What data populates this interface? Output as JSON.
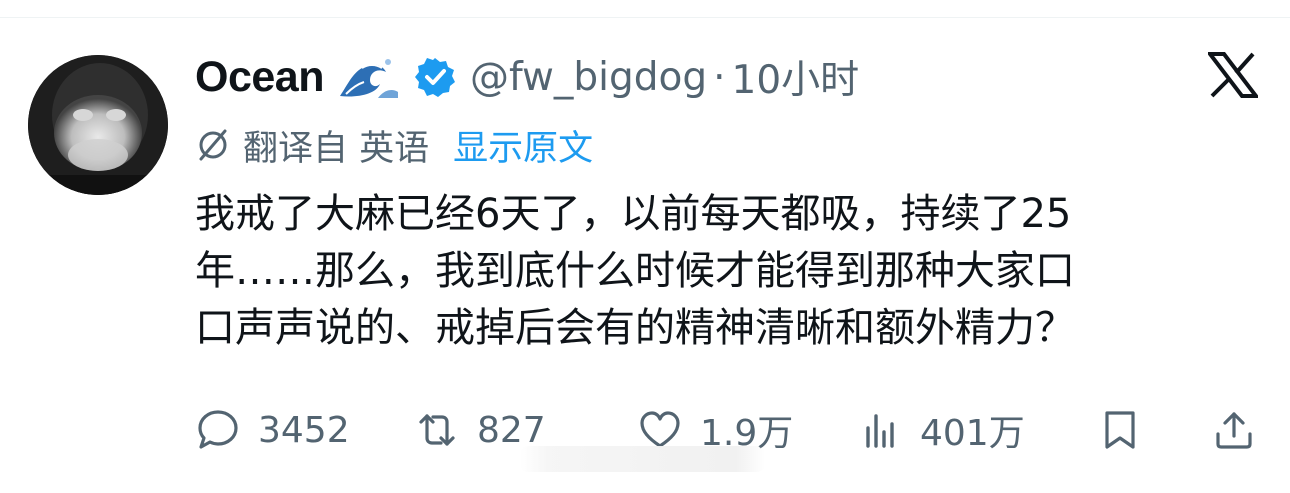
{
  "author": {
    "display_name": "Ocean",
    "handle": "@fw_bigdog",
    "separator": "·",
    "time": "10小时"
  },
  "translation": {
    "label": "翻译自 英语",
    "show_original": "显示原文"
  },
  "tweet": {
    "lines": [
      "我戒了大麻已经6天了，以前每天都吸，持续了25",
      "年……那么，我到底什么时候才能得到那种大家口",
      "口声声说的、戒掉后会有的精神清晰和额外精力？"
    ]
  },
  "actions": {
    "replies": "3452",
    "reposts": "827",
    "likes": "1.9万",
    "views": "401万"
  },
  "icons": {
    "platform_logo": "x-logo-icon",
    "verified": "verified-badge-icon",
    "emoji": "water-wave-emoji-icon",
    "translate": "translate-icon",
    "reply": "reply-icon",
    "repost": "repost-icon",
    "like": "heart-icon",
    "views": "views-chart-icon",
    "bookmark": "bookmark-icon",
    "share": "share-icon"
  },
  "colors": {
    "text_primary": "#0f1419",
    "text_secondary": "#536471",
    "link": "#1d9bf0",
    "verified": "#1d9bf0"
  }
}
